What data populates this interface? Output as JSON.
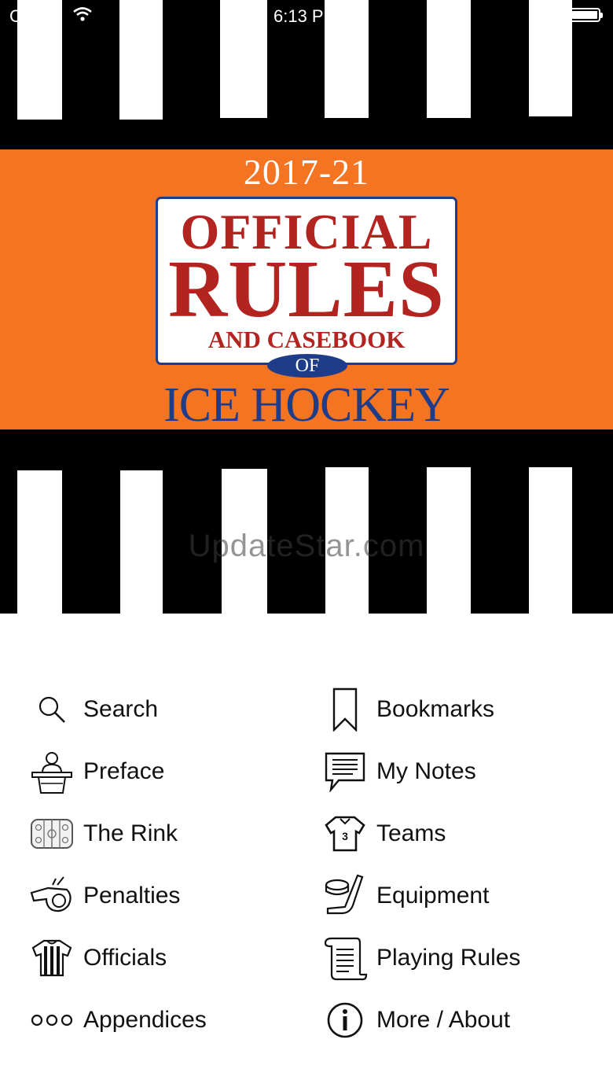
{
  "status_bar": {
    "carrier": "Carrier",
    "time": "6:13 PM"
  },
  "cover": {
    "year": "2017-21",
    "title_line1": "OFFICIAL",
    "title_line2": "RULES",
    "title_line3": "AND CASEBOOK",
    "of": "OF",
    "subtitle": "ICE HOCKEY",
    "watermark": "UpdateStar.com",
    "colors": {
      "band": "#f47421",
      "title_red": "#b3231f",
      "title_blue": "#1e3c8a"
    }
  },
  "menu": {
    "left": [
      {
        "label": "Search",
        "icon": "search-icon"
      },
      {
        "label": "Preface",
        "icon": "podium-speaker-icon"
      },
      {
        "label": "The Rink",
        "icon": "rink-icon"
      },
      {
        "label": "Penalties",
        "icon": "whistle-icon"
      },
      {
        "label": "Officials",
        "icon": "referee-jersey-icon"
      },
      {
        "label": "Appendices",
        "icon": "ellipsis-icon"
      }
    ],
    "right": [
      {
        "label": "Bookmarks",
        "icon": "bookmark-icon"
      },
      {
        "label": "My Notes",
        "icon": "notes-icon"
      },
      {
        "label": "Teams",
        "icon": "team-jersey-icon"
      },
      {
        "label": "Equipment",
        "icon": "stick-puck-icon"
      },
      {
        "label": "Playing Rules",
        "icon": "scroll-icon"
      },
      {
        "label": "More / About",
        "icon": "info-icon"
      }
    ]
  }
}
